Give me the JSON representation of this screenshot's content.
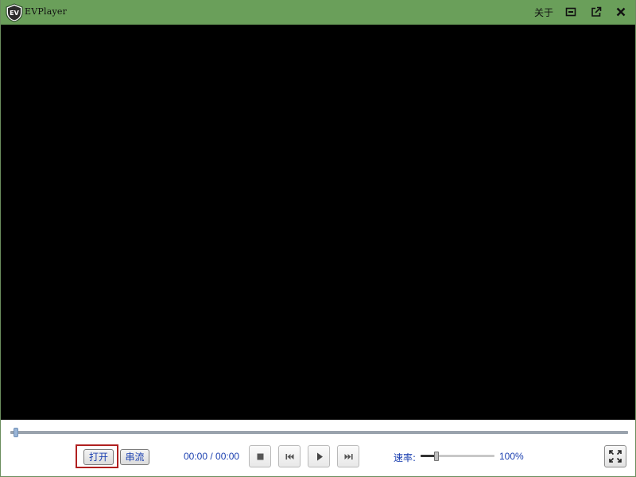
{
  "window": {
    "title": "EVPlayer",
    "logo_text": "EV",
    "about_label": "关于",
    "buttons": [
      "minimize-icon",
      "popout-icon",
      "close-icon"
    ]
  },
  "colors": {
    "titlebar": "#6a9f5a",
    "video_background": "#000000",
    "accent_text": "#1a3fb0",
    "highlight_border": "#b02020"
  },
  "controls": {
    "seek_position": 0.005,
    "open_label": "打开",
    "stream_label": "串流",
    "time_display": "00:00 / 00:00",
    "media_buttons": [
      "stop-icon",
      "previous-icon",
      "play-icon",
      "next-icon"
    ],
    "speed_label": "速率:",
    "speed_position": 0.22,
    "speed_value": "100%",
    "fullscreen_icon": "fullscreen-icon"
  }
}
